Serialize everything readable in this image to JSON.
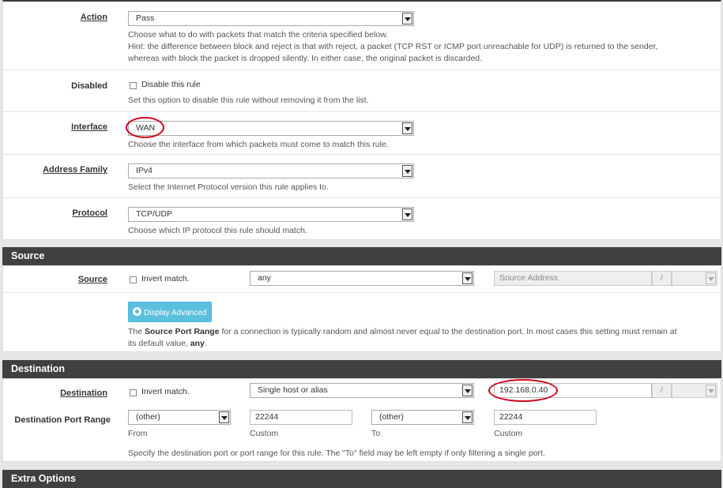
{
  "rule": {
    "action": {
      "label": "Action",
      "value": "Pass",
      "help1": "Choose what to do with packets that match the criteria specified below.",
      "help2": "Hint: the difference between block and reject is that with reject, a packet (TCP RST or ICMP port unreachable for UDP) is returned to the sender,",
      "help3": "whereas with block the packet is dropped silently. In either case, the original packet is discarded."
    },
    "disabled": {
      "label": "Disabled",
      "checkbox_label": "Disable this rule",
      "help": "Set this option to disable this rule without removing it from the list."
    },
    "interface": {
      "label": "Interface",
      "value": "WAN",
      "help": "Choose the interface from which packets must come to match this rule."
    },
    "address_family": {
      "label": "Address Family",
      "value": "IPv4",
      "help": "Select the Internet Protocol version this rule applies to."
    },
    "protocol": {
      "label": "Protocol",
      "value": "TCP/UDP",
      "help": "Choose which IP protocol this rule should match."
    }
  },
  "source": {
    "heading": "Source",
    "label": "Source",
    "invert_label": "Invert match.",
    "type_value": "any",
    "address_placeholder": "Source Address",
    "slash": "/",
    "advanced_button": "Display Advanced",
    "help_pre": "The ",
    "help_bold": "Source Port Range",
    "help_mid": " for a connection is typically random and almost never equal to the destination port. In most cases this setting must remain at",
    "help_line2_pre": "its default value, ",
    "help_line2_bold": "any",
    "help_line2_post": "."
  },
  "destination": {
    "heading": "Destination",
    "label": "Destination",
    "invert_label": "Invert match.",
    "type_value": "Single host or alias",
    "address_value": "192.168.0.40",
    "slash": "/",
    "port_range_label": "Destination Port Range",
    "from_select": "(other)",
    "from_custom": "22244",
    "to_select": "(other)",
    "to_custom": "22244",
    "from_caption": "From",
    "custom_caption": "Custom",
    "to_caption": "To",
    "custom_caption2": "Custom",
    "help": "Specify the destination port or port range for this rule. The \"To\" field may be left empty if only filtering a single port."
  },
  "extra": {
    "heading": "Extra Options"
  },
  "annotation_color": "#d0021b",
  "accent_button_color": "#5bc0de"
}
